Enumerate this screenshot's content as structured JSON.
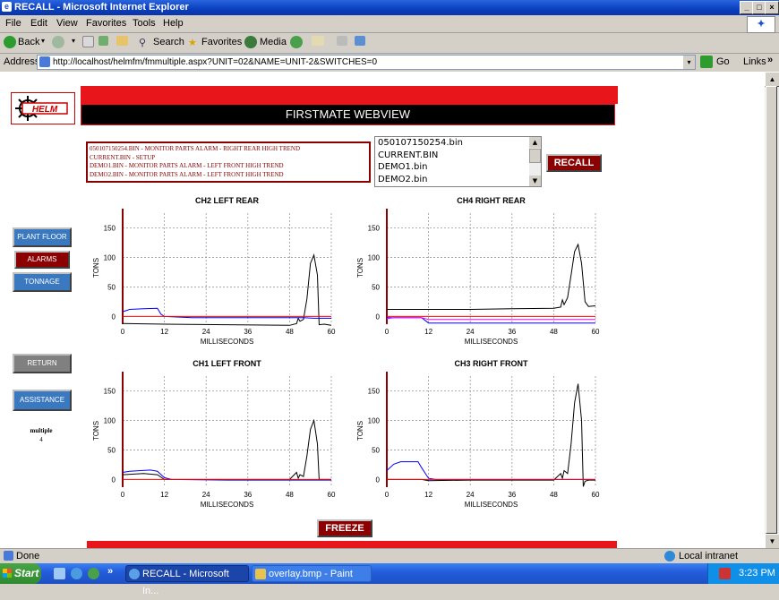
{
  "window": {
    "title": "RECALL - Microsoft Internet Explorer"
  },
  "menu": [
    "File",
    "Edit",
    "View",
    "Favorites",
    "Tools",
    "Help"
  ],
  "toolbar": {
    "back": "Back",
    "search": "Search",
    "favorites": "Favorites",
    "media": "Media"
  },
  "address": {
    "label": "Address",
    "url": "http://localhost/helmfm/fmmultiple.aspx?UNIT=02&NAME=UNIT-2&SWITCHES=0",
    "go": "Go",
    "links": "Links"
  },
  "page": {
    "logo_text": "HELM",
    "header_title": "FIRSTMATE WEBVIEW",
    "records": [
      "050107150254.BIN - MONITOR PARTS ALARM - RIGHT REAR HIGH TREND",
      "CURRENT.BIN - SETUP",
      "DEMO1.BIN - MONITOR PARTS ALARM - LEFT FRONT HIGH TREND",
      "DEMO2.BIN - MONITOR PARTS ALARM - LEFT FRONT HIGH TREND"
    ],
    "files": [
      "050107150254.bin",
      "CURRENT.BIN",
      "DEMO1.bin",
      "DEMO2.bin"
    ],
    "recall_label": "RECALL",
    "freeze_label": "FREEZE",
    "nav": {
      "plant_floor": "PLANT FLOOR",
      "alarms": "ALARMS",
      "tonnage": "TONNAGE",
      "return": "RETURN",
      "assistance": "ASSISTANCE"
    },
    "mode_label": "multiple",
    "mode_value": "4"
  },
  "status": {
    "text": "Done",
    "zone": "Local intranet"
  },
  "taskbar": {
    "start": "Start",
    "task1": "RECALL - Microsoft In...",
    "task2": "overlay.bmp - Paint",
    "clock": "3:23 PM"
  },
  "colors": {
    "accent_red": "#e8161b",
    "dark_red": "#8b0000",
    "nav_blue": "#3a78c0"
  },
  "chart_data": [
    {
      "type": "line",
      "title": "CH2 LEFT REAR",
      "xlabel": "MILLISECONDS",
      "ylabel": "TONS",
      "xlim": [
        0,
        60
      ],
      "ylim": [
        -10,
        175
      ],
      "xticks": [
        "0",
        "12",
        "24",
        "36",
        "48",
        "60"
      ],
      "yticks": [
        "0",
        "50",
        "100",
        "150"
      ],
      "series": [
        {
          "color": "#000000",
          "points": [
            [
              0,
              -12
            ],
            [
              12,
              -13
            ],
            [
              30,
              -14
            ],
            [
              48,
              -15
            ],
            [
              50,
              -12
            ],
            [
              50.5,
              -3
            ],
            [
              51,
              -8
            ],
            [
              52,
              -5
            ],
            [
              53,
              30
            ],
            [
              54,
              90
            ],
            [
              55,
              104
            ],
            [
              56,
              70
            ],
            [
              56.5,
              -14
            ],
            [
              58,
              -13
            ],
            [
              60,
              -15
            ]
          ]
        },
        {
          "color": "#0000ff",
          "points": [
            [
              0,
              8
            ],
            [
              2,
              12
            ],
            [
              6,
              13
            ],
            [
              10,
              14
            ],
            [
              11,
              4
            ],
            [
              12,
              0
            ],
            [
              20,
              -2
            ],
            [
              40,
              -2
            ],
            [
              50,
              -2
            ],
            [
              52,
              -2
            ],
            [
              55,
              -3
            ],
            [
              60,
              -3
            ]
          ]
        },
        {
          "color": "#ff0000",
          "points": [
            [
              0,
              0
            ],
            [
              60,
              0
            ]
          ]
        }
      ]
    },
    {
      "type": "line",
      "title": "CH4 RIGHT REAR",
      "xlabel": "MILLISECONDS",
      "ylabel": "TONS",
      "xlim": [
        0,
        60
      ],
      "ylim": [
        -10,
        175
      ],
      "xticks": [
        "0",
        "12",
        "24",
        "36",
        "48",
        "60"
      ],
      "yticks": [
        "0",
        "50",
        "100",
        "150"
      ],
      "series": [
        {
          "color": "#000000",
          "points": [
            [
              0,
              12
            ],
            [
              12,
              12
            ],
            [
              24,
              12
            ],
            [
              36,
              13
            ],
            [
              48,
              14
            ],
            [
              50,
              16
            ],
            [
              50.5,
              28
            ],
            [
              51,
              20
            ],
            [
              52,
              32
            ],
            [
              53,
              70
            ],
            [
              54,
              110
            ],
            [
              55,
              122
            ],
            [
              56,
              90
            ],
            [
              57,
              25
            ],
            [
              58,
              17
            ],
            [
              60,
              18
            ]
          ]
        },
        {
          "color": "#0000ff",
          "points": [
            [
              0,
              -2
            ],
            [
              10,
              -2
            ],
            [
              12,
              -11
            ],
            [
              30,
              -11
            ],
            [
              48,
              -11
            ],
            [
              60,
              -11
            ]
          ]
        },
        {
          "color": "#ff00ff",
          "points": [
            [
              0,
              -4
            ],
            [
              2,
              -2
            ],
            [
              10,
              -2
            ],
            [
              12,
              -5
            ],
            [
              60,
              -5
            ]
          ]
        },
        {
          "color": "#ff0000",
          "points": [
            [
              0,
              0
            ],
            [
              60,
              0
            ]
          ]
        }
      ]
    },
    {
      "type": "line",
      "title": "CH1 LEFT FRONT",
      "xlabel": "MILLISECONDS",
      "ylabel": "TONS",
      "xlim": [
        0,
        60
      ],
      "ylim": [
        -10,
        175
      ],
      "xticks": [
        "0",
        "12",
        "24",
        "36",
        "48",
        "60"
      ],
      "yticks": [
        "0",
        "50",
        "100",
        "150"
      ],
      "series": [
        {
          "color": "#000000",
          "points": [
            [
              0,
              8
            ],
            [
              6,
              10
            ],
            [
              10,
              8
            ],
            [
              12,
              0
            ],
            [
              24,
              0
            ],
            [
              40,
              0
            ],
            [
              48,
              0
            ],
            [
              50,
              12
            ],
            [
              50.5,
              2
            ],
            [
              51,
              8
            ],
            [
              52,
              5
            ],
            [
              53,
              40
            ],
            [
              54,
              85
            ],
            [
              55,
              100
            ],
            [
              56,
              60
            ],
            [
              56.5,
              0
            ],
            [
              60,
              0
            ]
          ]
        },
        {
          "color": "#0000ff",
          "points": [
            [
              0,
              12
            ],
            [
              2,
              14
            ],
            [
              8,
              16
            ],
            [
              10,
              14
            ],
            [
              12,
              3
            ],
            [
              14,
              0
            ],
            [
              30,
              -1
            ],
            [
              48,
              -1
            ],
            [
              60,
              -1
            ]
          ]
        },
        {
          "color": "#ff0000",
          "points": [
            [
              0,
              0
            ],
            [
              60,
              0
            ]
          ]
        }
      ]
    },
    {
      "type": "line",
      "title": "CH3 RIGHT FRONT",
      "xlabel": "MILLISECONDS",
      "ylabel": "TONS",
      "xlim": [
        0,
        60
      ],
      "ylim": [
        -10,
        175
      ],
      "xticks": [
        "0",
        "12",
        "24",
        "36",
        "48",
        "60"
      ],
      "yticks": [
        "0",
        "50",
        "100",
        "150"
      ],
      "series": [
        {
          "color": "#000000",
          "points": [
            [
              0,
              0
            ],
            [
              10,
              0
            ],
            [
              12,
              -2
            ],
            [
              24,
              -1
            ],
            [
              48,
              -1
            ],
            [
              50,
              10
            ],
            [
              50.5,
              2
            ],
            [
              51,
              15
            ],
            [
              52,
              10
            ],
            [
              53,
              60
            ],
            [
              54,
              130
            ],
            [
              55,
              162
            ],
            [
              56,
              100
            ],
            [
              56.5,
              -12
            ],
            [
              57,
              -3
            ],
            [
              58,
              -1
            ],
            [
              60,
              -1
            ]
          ]
        },
        {
          "color": "#0000ff",
          "points": [
            [
              0,
              15
            ],
            [
              2,
              26
            ],
            [
              4,
              30
            ],
            [
              9,
              30
            ],
            [
              10,
              20
            ],
            [
              12,
              2
            ],
            [
              14,
              0
            ],
            [
              30,
              0
            ],
            [
              48,
              0
            ],
            [
              60,
              0
            ]
          ]
        },
        {
          "color": "#ff0000",
          "points": [
            [
              0,
              0
            ],
            [
              60,
              0
            ]
          ]
        }
      ]
    }
  ]
}
